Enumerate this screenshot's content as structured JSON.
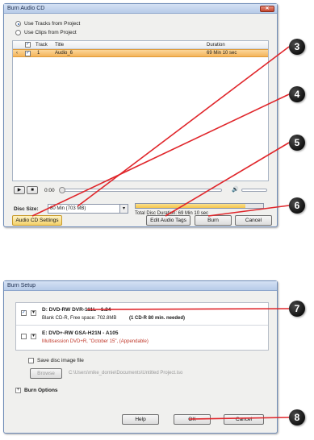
{
  "burn_audio_cd": {
    "title": "Burn Audio CD",
    "options": [
      {
        "label": "Use Tracks from Project",
        "selected": true
      },
      {
        "label": "Use Clips from Project",
        "selected": false
      }
    ],
    "columns": {
      "track": "Track",
      "title": "Title",
      "duration": "Duration"
    },
    "tracks": [
      {
        "checked": true,
        "track": "1",
        "title": "Audio_6",
        "duration": "69 Min 10 sec"
      }
    ],
    "time_display": "0:00",
    "disc_size_label": "Disc Size:",
    "disc_size_value": "80 Min (703 MB)",
    "total_duration": "Total Disc Duration: 69 Min 10 sec",
    "total_fraction": 0.86,
    "buttons": {
      "settings": "Audio CD Settings",
      "edit_tags": "Edit Audio Tags",
      "burn": "Burn",
      "cancel": "Cancel"
    }
  },
  "burn_setup": {
    "title": "Burn Setup",
    "drives": [
      {
        "checked": true,
        "name": "D: DVD-RW  DVR-111L - 1.24",
        "info": "Blank CD-R, Free space: 702.8MB",
        "note": "(1 CD-R 80 min. needed)"
      },
      {
        "checked": false,
        "name": "E: DVD+-RW GSA-H21N - A105",
        "info": "Multisession DVD+R, \"October 15\", (Appendable)",
        "note": ""
      }
    ],
    "save_image_label": "Save disc image file",
    "browse_label": "Browse",
    "image_path": "C:\\Users\\mike_dornie\\Documents\\Untitled Project.iso",
    "burn_options_label": "Burn Options",
    "buttons": {
      "help": "Help",
      "ok": "OK",
      "cancel": "Cancel"
    }
  },
  "callouts": [
    "3",
    "4",
    "5",
    "6",
    "7",
    "8"
  ],
  "colors": {
    "accent": "#f4b45a",
    "callout_line": "#e0262b",
    "window_border": "#6f8cb8"
  }
}
